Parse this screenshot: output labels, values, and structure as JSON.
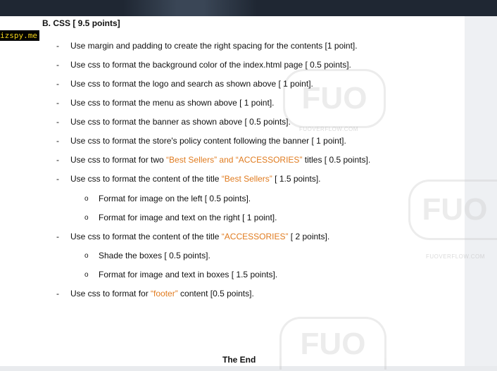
{
  "section": {
    "title": "B. CSS  [ 9.5 points]"
  },
  "badge": {
    "text": "izspy.me"
  },
  "items": [
    {
      "type": "dash",
      "parts": [
        "Use margin and padding to create the right spacing for the contents [1 point]."
      ]
    },
    {
      "type": "dash",
      "parts": [
        "Use css to format the background color of the index.html page [ 0.5 points]."
      ]
    },
    {
      "type": "dash",
      "parts": [
        "Use css to format the logo and search as shown above [ 1 point]."
      ]
    },
    {
      "type": "dash",
      "parts": [
        "Use css to format the menu as shown above [ 1 point]."
      ]
    },
    {
      "type": "dash",
      "parts": [
        "Use css to format the banner as shown above [ 0.5 points]."
      ]
    },
    {
      "type": "dash",
      "parts": [
        "Use css to format the store's policy content following the banner [ 1 point]."
      ]
    },
    {
      "type": "dash",
      "parts": [
        "Use css to format for two ",
        "“Best Sellers”  and “ACCESSORIES”",
        "  titles [ 0.5 points]."
      ]
    },
    {
      "type": "dash",
      "parts": [
        "Use css to format the content of the title ",
        "“Best Sellers”",
        " [ 1.5 points]."
      ]
    },
    {
      "type": "circle",
      "parts": [
        "Format for image on the left [ 0.5 points]."
      ]
    },
    {
      "type": "circle",
      "parts": [
        "Format for image and text on the right [ 1 point]."
      ]
    },
    {
      "type": "dash",
      "parts": [
        "Use css to format the content of the title ",
        "“ACCESSORIES”",
        " [ 2 points]."
      ]
    },
    {
      "type": "circle",
      "parts": [
        "Shade the boxes [ 0.5 points]."
      ]
    },
    {
      "type": "circle",
      "parts": [
        "Format for image and text in boxes [ 1.5 points]."
      ]
    },
    {
      "type": "dash",
      "parts": [
        "Use css  to format  for  ",
        "“footer”",
        " content [0.5 points]."
      ]
    }
  ],
  "markers": {
    "dash": "-",
    "circle": "o"
  },
  "footer": {
    "text": "The End"
  },
  "watermark": {
    "logo": "FUO",
    "url": "FUOVERFLOW.COM"
  },
  "colors": {
    "highlight": "#e07b1f",
    "topbar": "#1f2733"
  }
}
